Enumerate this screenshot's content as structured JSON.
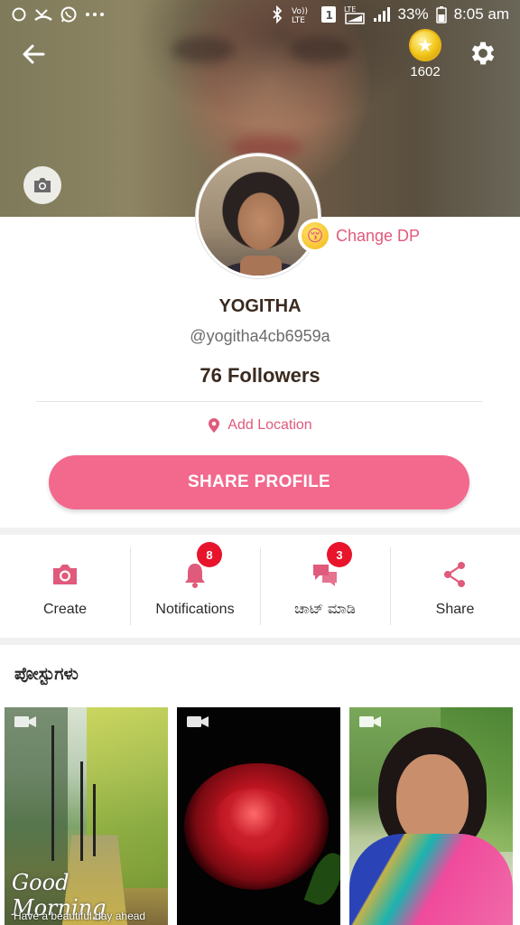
{
  "status_bar": {
    "left_icons": [
      "circle-icon",
      "missed-call-icon",
      "whatsapp-icon",
      "more-dots-icon"
    ],
    "network_label_1": "Vo)\nLTE",
    "sim": "1",
    "network_label_2": "LTE",
    "battery": "33%",
    "time": "8:05 am"
  },
  "header": {
    "coin_count": "1602"
  },
  "profile": {
    "change_dp_label": "Change DP",
    "name": "YOGITHA",
    "handle": "@yogitha4cb6959a",
    "followers": "76 Followers",
    "add_location_label": "Add Location",
    "share_profile_label": "SHARE PROFILE"
  },
  "actions": [
    {
      "label": "Create",
      "icon": "camera-icon",
      "badge": ""
    },
    {
      "label": "Notifications",
      "icon": "bell-icon",
      "badge": "8"
    },
    {
      "label": "ಚಾಟ್ ಮಾಡಿ",
      "icon": "chat-icon",
      "badge": "3"
    },
    {
      "label": "Share",
      "icon": "share-icon",
      "badge": ""
    }
  ],
  "posts": {
    "title": "ಪೋಸ್ಟುಗಳು",
    "items": [
      {
        "overlay_title": "Good Morning",
        "overlay_subtitle": "Have a beautiful day ahead"
      },
      {
        "overlay_title": "",
        "overlay_subtitle": ""
      },
      {
        "overlay_title": "",
        "overlay_subtitle": ""
      }
    ]
  },
  "colors": {
    "accent": "#f2698d",
    "accent_text": "#e05a7c",
    "badge": "#e8142b"
  }
}
